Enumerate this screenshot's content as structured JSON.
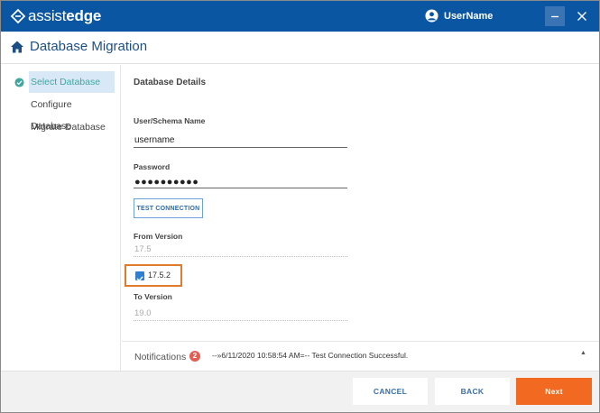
{
  "app": {
    "logo_light": "assist",
    "logo_bold": "edge",
    "user_name": "UserName"
  },
  "header": {
    "title": "Database Migration",
    "icon": "home-icon"
  },
  "sidebar": {
    "items": [
      {
        "label": "Select Database",
        "active": true,
        "icon": "check-circle-icon"
      },
      {
        "label": "Configure Database",
        "active": false
      },
      {
        "label": "Migrate Database",
        "active": false
      }
    ]
  },
  "details": {
    "section_title": "Database Details",
    "user_label": "User/Schema Name",
    "user_value": "username",
    "password_label": "Password",
    "password_value": "●●●●●●●●●●",
    "test_button": "TEST CONNECTION",
    "from_label": "From Version",
    "from_value": "17.5",
    "checkbox_label": "17.5.2",
    "checkbox_checked": true,
    "to_label": "To Version",
    "to_value": "19.0"
  },
  "notifications": {
    "title": "Notifications",
    "count": "2",
    "message": "--»6/11/2020 10:58:54 AM=-- Test Connection Successful."
  },
  "footer": {
    "cancel": "CANCEL",
    "back": "BACK",
    "next": "Next"
  },
  "colors": {
    "titlebar": "#0a56a3",
    "accent": "#f26a21",
    "active_bg": "#d9e8f6",
    "active_text": "#41a6a0",
    "badge": "#e15f54",
    "highlight": "#e07a2c"
  }
}
